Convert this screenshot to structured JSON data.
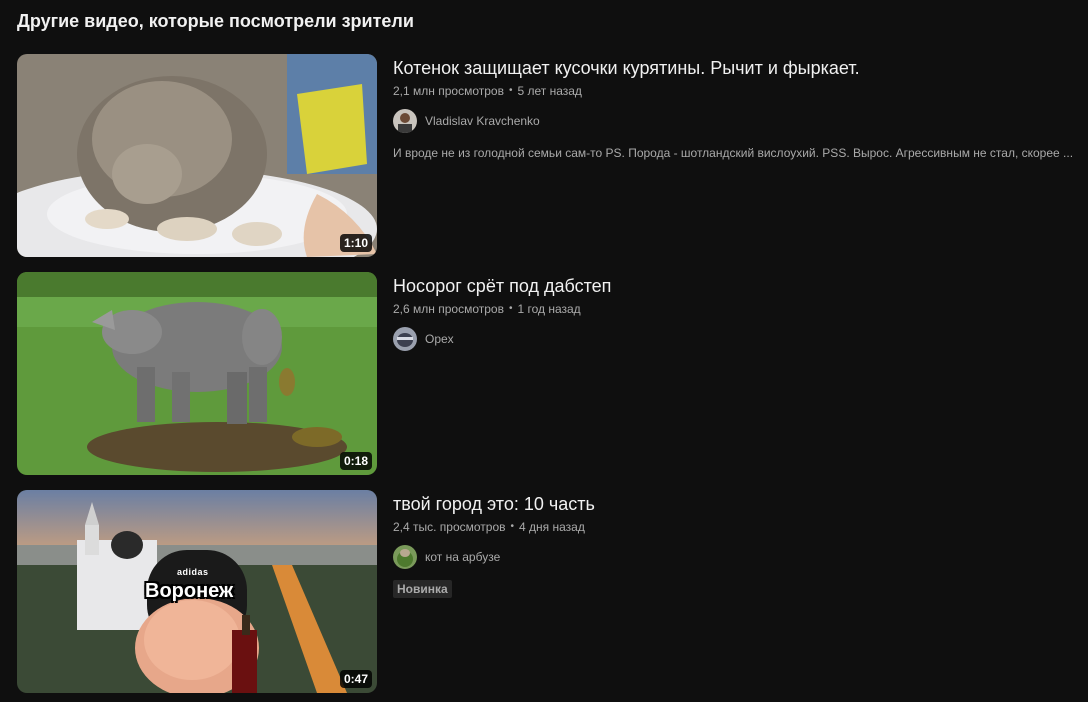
{
  "section": {
    "title": "Другие видео, которые посмотрели зрители"
  },
  "videos": [
    {
      "title": "Котенок защищает кусочки курятины. Рычит и фыркает.",
      "views": "2,1 млн просмотров",
      "age": "5 лет назад",
      "channel": "Vladislav Kravchenko",
      "description": "И вроде не из голодной семьи сам-то PS. Порода - шотландский вислоухий. PSS. Вырос. Агрессивным не стал, скорее ...",
      "duration": "1:10",
      "thumbnail_icon": "kitten-eating-thumbnail"
    },
    {
      "title": "Носорог срёт под дабстеп",
      "views": "2,6 млн просмотров",
      "age": "1 год назад",
      "channel": "Opex",
      "duration": "0:18",
      "thumbnail_icon": "rhino-thumbnail"
    },
    {
      "title": "твой город это: 10 часть",
      "views": "2,4 тыс. просмотров",
      "age": "4 дня назад",
      "channel": "кот на арбузе",
      "badge": "Новинка",
      "duration": "0:47",
      "thumbnail_icon": "voronezh-city-thumbnail",
      "overlay_text": "Воронеж",
      "cap_text": "adidas"
    }
  ],
  "separator": "•",
  "colors": {
    "background": "#0f0f0f",
    "text_primary": "#f1f1f1",
    "text_secondary": "#aaaaaa",
    "badge_bg": "#272727"
  }
}
